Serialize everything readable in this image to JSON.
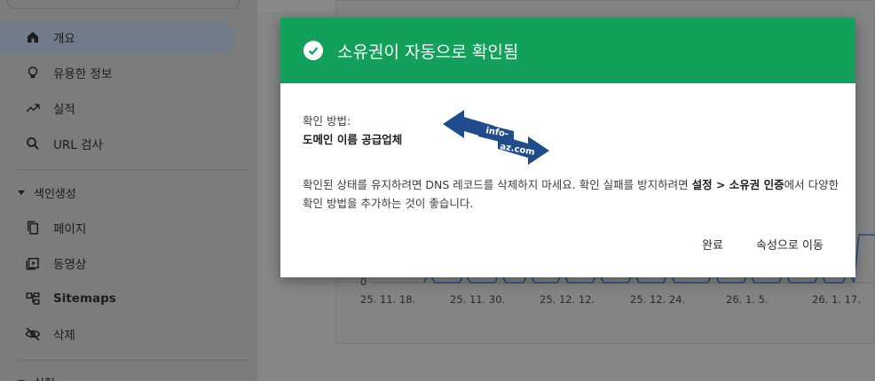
{
  "sidebar": {
    "items": [
      {
        "label": "개요",
        "icon": "home-icon",
        "active": true
      },
      {
        "label": "유용한 정보",
        "icon": "lightbulb-icon"
      },
      {
        "label": "실적",
        "icon": "trending-up-icon"
      },
      {
        "label": "URL 검사",
        "icon": "search-icon"
      }
    ],
    "section_index": "색인생성",
    "index_items": [
      {
        "label": "페이지",
        "icon": "pages-icon"
      },
      {
        "label": "동영상",
        "icon": "video-icon"
      },
      {
        "label": "Sitemaps",
        "icon": "sitemap-icon"
      },
      {
        "label": "삭제",
        "icon": "visibility-off-icon"
      }
    ],
    "section_next": "실험"
  },
  "chart": {
    "y_tick": "0",
    "x_ticks": [
      "25. 11. 18.",
      "25. 11. 30.",
      "25. 12. 12.",
      "25. 12. 24.",
      "26. 1. 5.",
      "26. 1. 17."
    ]
  },
  "dialog": {
    "title": "소유권이 자동으로 확인됨",
    "method_label": "확인 방법:",
    "method_value": "도메인 이름 공급업체",
    "logo_text_1": "info-",
    "logo_text_2": "az.com",
    "body_part1": "확인된 상태를 유지하려면 DNS 레코드를 삭제하지 마세요. 확인 실패를 방지하려면 ",
    "body_bold": "설정 > 소유권 인증",
    "body_part2": "에서 다양한 확인 방법을 추가하는 것이 좋습니다.",
    "done_button": "완료",
    "go_property_button": "속성으로 이동"
  },
  "colors": {
    "header_green": "#12a05a",
    "logo_blue": "#1f4d8c"
  }
}
